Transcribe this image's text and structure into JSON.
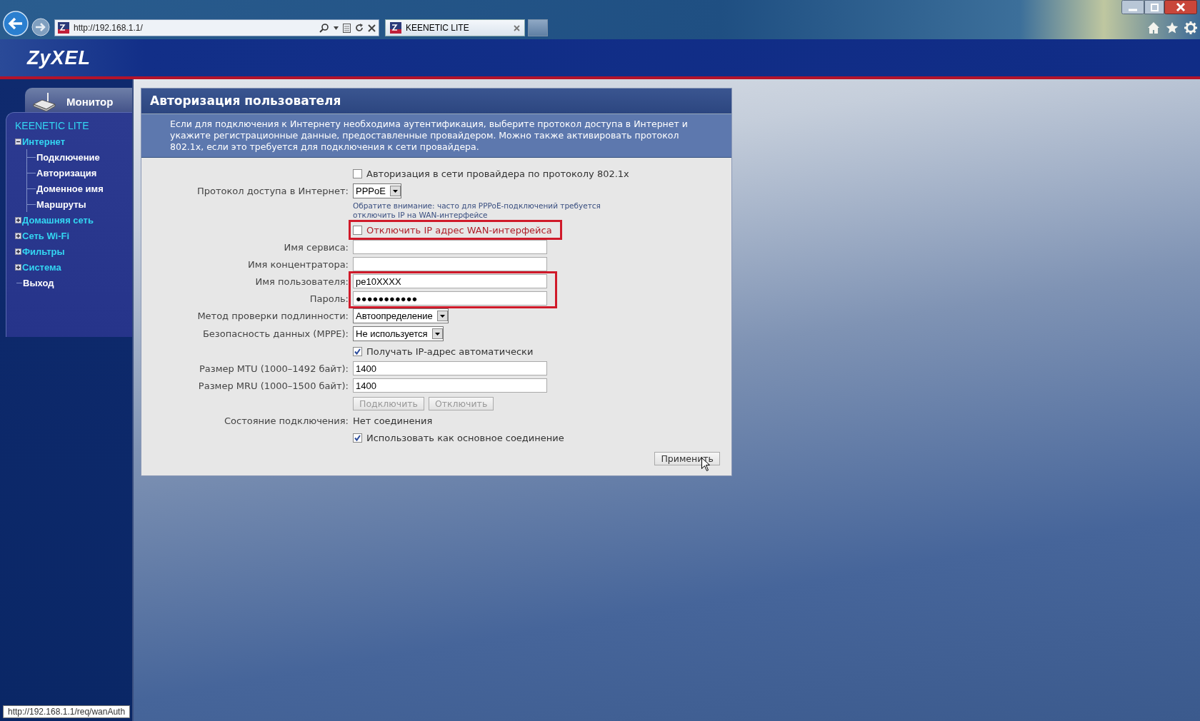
{
  "browser": {
    "url": "http://192.168.1.1/",
    "tabs": [
      {
        "title": "KEENETIC LITE",
        "selected": true
      }
    ],
    "status_url": "http://192.168.1.1/req/wanAuth"
  },
  "header": {
    "logo": "ZyXEL"
  },
  "sidebar": {
    "monitor_tab": "Монитор",
    "device": "KEENETIC LITE",
    "tree": [
      {
        "kind": "folder",
        "label": "Интернет",
        "expanded": true,
        "children": [
          {
            "kind": "link",
            "label": "Подключение"
          },
          {
            "kind": "link",
            "label": "Авторизация"
          },
          {
            "kind": "link",
            "label": "Доменное имя"
          },
          {
            "kind": "link",
            "label": "Маршруты"
          }
        ]
      },
      {
        "kind": "folder",
        "label": "Домашняя сеть",
        "expanded": false
      },
      {
        "kind": "folder",
        "label": "Сеть Wi-Fi",
        "expanded": false
      },
      {
        "kind": "folder",
        "label": "Фильтры",
        "expanded": false
      },
      {
        "kind": "folder",
        "label": "Система",
        "expanded": false
      },
      {
        "kind": "link",
        "label": "Выход"
      }
    ]
  },
  "panel": {
    "title": "Авторизация пользователя",
    "description": "Если для подключения к Интернету необходима аутентификация, выберите протокол доступа в Интернет и укажите регистрационные данные, предоставленные провайдером. Можно также активировать протокол 802.1x, если это требуется для подключения к сети провайдера.",
    "rows": [
      {
        "kind": "checkbox",
        "label": "Авторизация в сети провайдера по протоколу 802.1x",
        "checked": false
      },
      {
        "kind": "select",
        "label": "Протокол доступа в Интернет:",
        "value": "PPPoE"
      },
      {
        "kind": "note",
        "text": "Обратите внимание: часто для PPPoE-подключений требуется отключить IP на WAN-интерфейсе"
      },
      {
        "kind": "highlight",
        "fields": [
          {
            "kind": "checkbox",
            "label": "Отключить IP адрес WAN-интерфейса",
            "checked": false
          }
        ]
      },
      {
        "kind": "text",
        "label": "Имя сервиса:",
        "value": ""
      },
      {
        "kind": "text",
        "label": "Имя концентратора:",
        "value": ""
      },
      {
        "kind": "highlight",
        "fields": [
          {
            "kind": "text",
            "label": "Имя пользователя:",
            "value": "pe10XXXX"
          },
          {
            "kind": "text",
            "label": "Пароль:",
            "value": "●●●●●●●●●●●"
          }
        ]
      },
      {
        "kind": "select",
        "label": "Метод проверки подлинности:",
        "value": "Автоопределение"
      },
      {
        "kind": "select",
        "label": "Безопасность данных (MPPE):",
        "value": "Не используется"
      },
      {
        "kind": "checkbox",
        "label": "Получать IP-адрес автоматически",
        "checked": true
      },
      {
        "kind": "text",
        "label": "Размер MTU (1000–1492 байт):",
        "value": "1400"
      },
      {
        "kind": "text",
        "label": "Размер MRU (1000–1500 байт):",
        "value": "1400"
      },
      {
        "kind": "buttons",
        "buttons": [
          {
            "label": "Подключить",
            "disabled": true
          },
          {
            "label": "Отключить",
            "disabled": true
          }
        ]
      },
      {
        "kind": "status",
        "label": "Состояние подключения:",
        "value": "Нет соединения"
      },
      {
        "kind": "checkbox",
        "label": "Использовать как основное соединение",
        "checked": true
      }
    ],
    "apply": "Применить"
  }
}
